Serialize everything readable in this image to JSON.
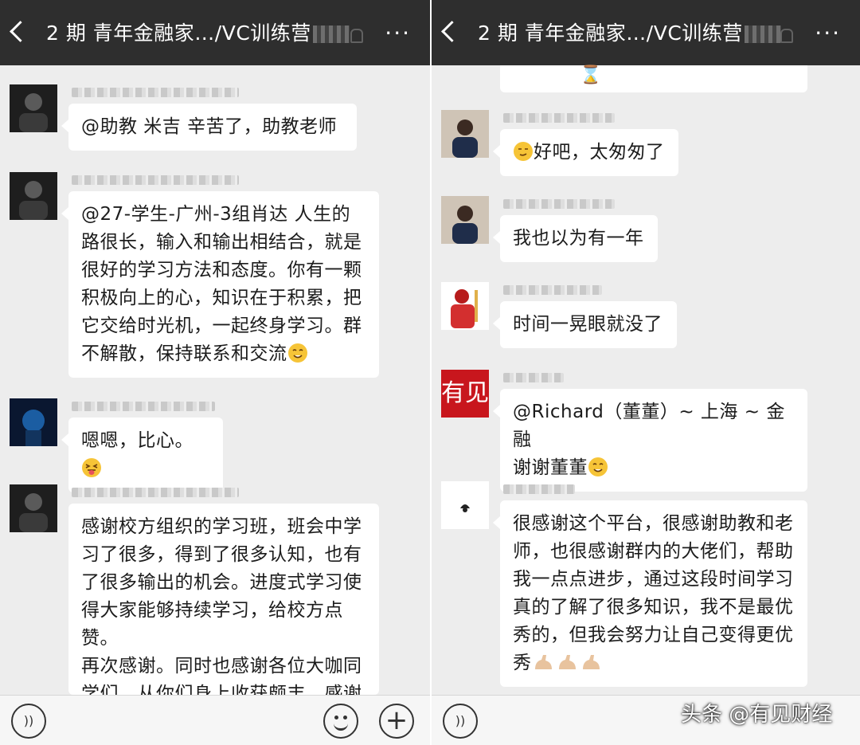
{
  "left": {
    "title": "2 期 青年金融家…/VC训练营",
    "messages": [
      {
        "text": "@助教 米吉  辛苦了，助教老师"
      },
      {
        "lines": [
          "@27-学生-广州-3组肖达  人生的",
          "路很长，输入和输出相结合，就是",
          "很好的学习方法和态度。你有一颗",
          "积极向上的心，知识在于积累，把",
          "它交给时光机，一起终身学习。群",
          "不解散，保持联系和交流"
        ]
      },
      {
        "text": "嗯嗯，比心。"
      },
      {
        "lines": [
          "感谢校方组织的学习班，班会中学",
          "习了很多，得到了很多认知，也有",
          "了很多输出的机会。进度式学习使",
          "得大家能够持续学习，给校方点赞。",
          "再次感谢。同时也感谢各位大咖同",
          "学们，从你们身上收获颇丰，感谢"
        ]
      }
    ]
  },
  "right": {
    "title": "2 期 青年金融家…/VC训练营",
    "messages": [
      {
        "text": "好吧，太匆匆了"
      },
      {
        "text": "我也以为有一年"
      },
      {
        "text": "时间一晃眼就没了"
      },
      {
        "lines": [
          "@Richard（董董）~ 上海 ~ 金融",
          "谢谢董董"
        ]
      },
      {
        "lines": [
          "很感谢这个平台，很感谢助教和老",
          "师，也很感谢群内的大佬们，帮助",
          "我一点点进步，通过这段时间学习",
          "真的了解了很多知识，我不是最优",
          "秀的，但我会努力让自己变得更优",
          "秀"
        ]
      }
    ],
    "logo_text": "有见"
  },
  "icons": {
    "back": "back-chevron-icon",
    "more": "more-icon",
    "more_glyph": "···",
    "voice": "voice-icon",
    "voice_glyph": "))",
    "emoji": "emoji-icon",
    "plus": "plus-icon",
    "plus_glyph": "+"
  },
  "watermark": "头条 @有见财经",
  "colors": {
    "titlebar": "#2e2e2e",
    "chat_bg": "#ededed",
    "bubble": "#ffffff",
    "text": "#1c1c1c",
    "logo_red": "#c8161d"
  }
}
